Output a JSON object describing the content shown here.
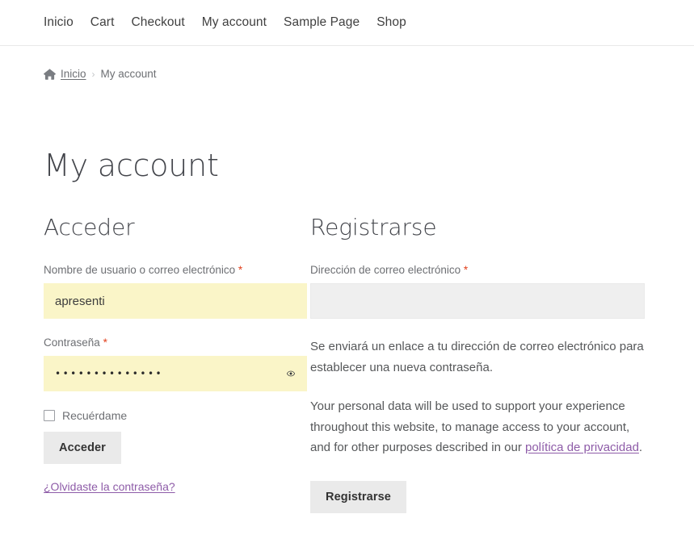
{
  "nav": {
    "items": [
      {
        "label": "Inicio"
      },
      {
        "label": "Cart"
      },
      {
        "label": "Checkout"
      },
      {
        "label": "My account"
      },
      {
        "label": "Sample Page"
      },
      {
        "label": "Shop"
      }
    ]
  },
  "breadcrumb": {
    "home_icon": "home-icon",
    "home_label": "Inicio",
    "separator": "›",
    "current": "My account"
  },
  "page": {
    "title": "My account"
  },
  "login": {
    "heading": "Acceder",
    "username_label": "Nombre de usuario o correo electrónico",
    "username_required": "*",
    "username_value": "apresenti",
    "username_placeholder": "",
    "password_label": "Contraseña",
    "password_required": "*",
    "password_value": "••••••••••••••",
    "password_placeholder": "",
    "show_password_icon": "eye-icon",
    "remember_label": "Recuérdame",
    "remember_checked": false,
    "submit_label": "Acceder",
    "lost_password_label": "¿Olvidaste la contraseña?"
  },
  "register": {
    "heading": "Registrarse",
    "email_label": "Dirección de correo electrónico",
    "email_required": "*",
    "email_value": "",
    "email_placeholder": "",
    "info_text": "Se enviará un enlace a tu dirección de correo electrónico para establecer una nueva contraseña.",
    "privacy_text_before": "Your personal data will be used to support your experience throughout this website, to manage access to your account, and for other purposes described in our ",
    "privacy_link_label": "política de privacidad",
    "privacy_text_after": ".",
    "submit_label": "Registrarse"
  },
  "colors": {
    "autofill_yellow": "#faf5c8",
    "input_gray": "#efefef",
    "button_gray": "#eaeaea",
    "link_purple": "#8e5ca8",
    "required_red": "#e2401c",
    "text": "#43454b",
    "muted_text": "#6d6f73"
  }
}
